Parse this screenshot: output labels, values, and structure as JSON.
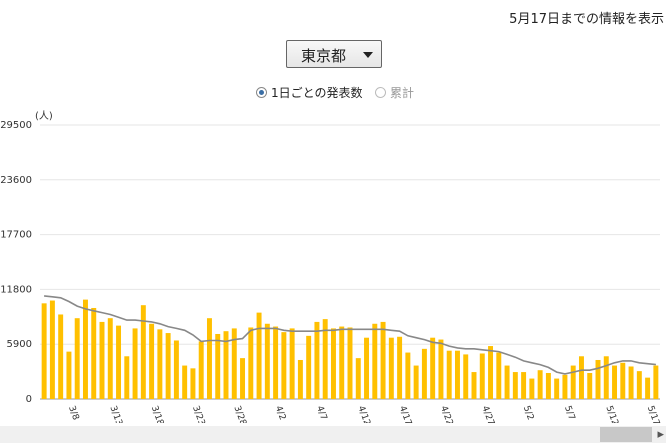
{
  "header": {
    "note": "5月17日までの情報を表示"
  },
  "region_select": {
    "selected": "東京都"
  },
  "view_toggle": {
    "daily_label": "1日ごとの発表数",
    "cumulative_label": "累計",
    "selected": "daily"
  },
  "chart_data": {
    "type": "bar",
    "ylabel": "(人)",
    "ylim": [
      0,
      29500
    ],
    "yticks": [
      0,
      5900,
      11800,
      17700,
      23600,
      29500
    ],
    "x_tick_labels": [
      "3/8",
      "3/13",
      "3/18",
      "3/23",
      "3/28",
      "4/2",
      "4/7",
      "4/12",
      "4/17",
      "4/22",
      "4/27",
      "5/2",
      "5/7",
      "5/12",
      "5/17"
    ],
    "grid": true,
    "series": [
      {
        "type": "bar",
        "color": "#ffc000",
        "values": [
          10300,
          10600,
          9100,
          5100,
          8700,
          10700,
          9800,
          8300,
          8700,
          7900,
          4600,
          7600,
          10100,
          8100,
          7500,
          7100,
          6300,
          3600,
          3300,
          6200,
          8700,
          7000,
          7300,
          7600,
          4400,
          7700,
          9300,
          8100,
          7800,
          7200,
          7600,
          4200,
          6800,
          8300,
          8600,
          7600,
          7800,
          7700,
          4400,
          6600,
          8100,
          8300,
          6600,
          6700,
          5000,
          3600,
          5400,
          6600,
          6400,
          5200,
          5200,
          4800,
          2900,
          4900,
          5700,
          5000,
          3600,
          2900,
          2900,
          2200,
          3100,
          2800,
          2200,
          2600,
          3600,
          4600,
          2800,
          4200,
          4600,
          3600,
          3900,
          3500,
          3000,
          2300,
          3600
        ]
      },
      {
        "type": "line",
        "color": "#888888",
        "values": [
          11100,
          11000,
          10900,
          10500,
          10000,
          9700,
          9500,
          9300,
          9100,
          8800,
          8500,
          8500,
          8400,
          8300,
          8100,
          7800,
          7600,
          7400,
          6900,
          6200,
          6300,
          6300,
          6200,
          6400,
          6500,
          7400,
          7600,
          7600,
          7600,
          7400,
          7300,
          7300,
          7300,
          7300,
          7400,
          7400,
          7500,
          7500,
          7500,
          7500,
          7500,
          7500,
          7400,
          7300,
          6800,
          6600,
          6400,
          6100,
          6000,
          5700,
          5500,
          5400,
          5400,
          5300,
          5200,
          5100,
          4800,
          4500,
          4100,
          3900,
          3700,
          3400,
          2900,
          2700,
          2900,
          3100,
          3100,
          3300,
          3600,
          3900,
          4100,
          4100,
          3900,
          3800,
          3700
        ]
      }
    ]
  }
}
